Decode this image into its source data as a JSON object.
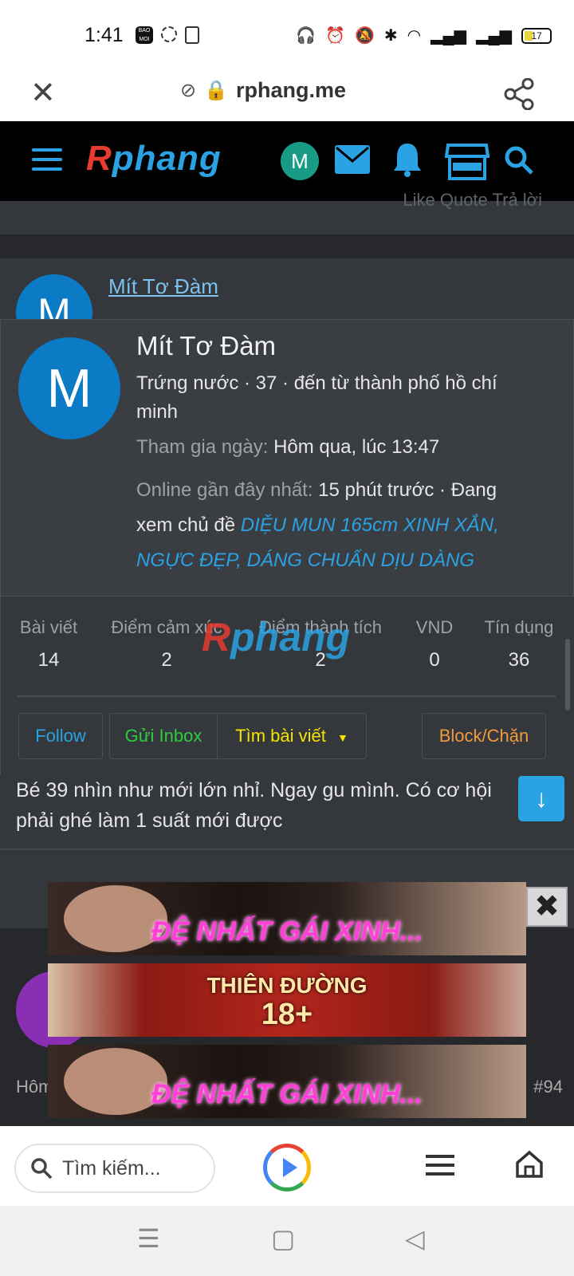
{
  "status_bar": {
    "time": "1:41",
    "battery": "17",
    "bao_moi": "BAO MOI"
  },
  "browser": {
    "url": "rphang.me",
    "search_placeholder": "Tìm kiếm..."
  },
  "site": {
    "logo": "Rphang"
  },
  "header_avatar": {
    "letter": "M"
  },
  "backdrop": {
    "post_actions": "Like   Quote   Trả lời",
    "author": "Mít Tơ Đàm",
    "message": "Bé 39 nhìn như mới lớn nhỉ. Ngay gu mình. Có cơ hội phải ghé làm 1 suất mới được",
    "next_post_time": "Hôm",
    "next_post_number": "#94"
  },
  "member_card": {
    "avatar_letter": "M",
    "name": "Mít Tơ Đàm",
    "info": "Trứng nước · 37 · đến từ thành phố hồ chí minh",
    "joined_label": "Tham gia ngày:",
    "joined_value": "Hôm qua, lúc 13:47",
    "online_label": "Online gần đây nhất:",
    "online_value": "15 phút trước · Đang xem chủ đề",
    "thread_link": "DIỆU MUN 165cm XINH XẮN, NGỰC ĐẸP, DÁNG CHUẨN DỊU DÀNG",
    "stats": [
      {
        "label": "Bài viết",
        "value": "14"
      },
      {
        "label": "Điểm cảm xúc",
        "value": "2"
      },
      {
        "label": "Điểm thành tích",
        "value": "2"
      },
      {
        "label": "VND",
        "value": "0"
      },
      {
        "label": "Tín dụng",
        "value": "36"
      }
    ],
    "buttons": {
      "follow": "Follow",
      "inbox": "Gửi Inbox",
      "find_posts": "Tìm bài viết",
      "block": "Block/Chặn"
    },
    "watermark": "Rphang"
  },
  "ads": {
    "banner1": "ĐỆ NHẤT GÁI XINH...",
    "banner2_line1": "THIÊN ĐƯỜNG",
    "banner2_line2": "18+",
    "banner3": "ĐỆ NHẤT GÁI XINH...",
    "close": "✖"
  },
  "colors": {
    "accent": "#2ba2e3",
    "follow": "#2ba2e3",
    "inbox": "#2ecc40",
    "find": "#f5e300",
    "block": "#f09a3e"
  }
}
